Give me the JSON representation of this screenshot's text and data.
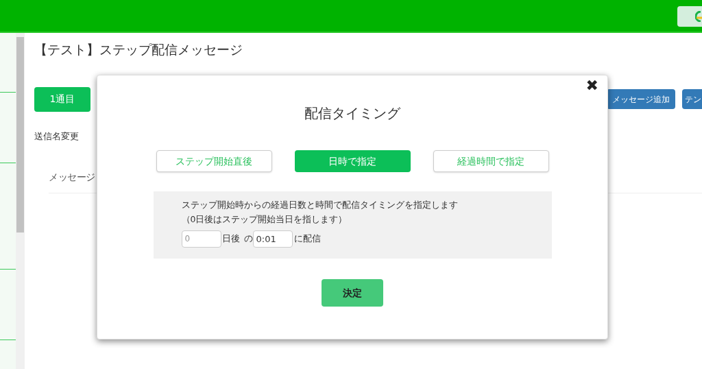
{
  "page": {
    "title": "【テスト】ステップ配信メッセージ",
    "tabs": [
      {
        "label": "1通目",
        "selected": true
      }
    ],
    "actions": [
      "メッセージ追加",
      "テン"
    ],
    "rename_link": "送信名変更",
    "section": "メッセージ"
  },
  "modal": {
    "title": "配信タイミング",
    "close": "✖",
    "options": [
      {
        "label": "ステップ開始直後",
        "selected": false
      },
      {
        "label": "日時で指定",
        "selected": true
      },
      {
        "label": "経過時間で指定",
        "selected": false
      }
    ],
    "description": "ステップ開始時からの経過日数と時間で配信タイミングを指定します",
    "note": "（0日後はステップ開始当日を指します）",
    "days": {
      "placeholder": "0"
    },
    "days_label": "日後",
    "of_label": "の",
    "time": {
      "value": "0:01"
    },
    "suffix": "に配信",
    "submit": "決定"
  }
}
